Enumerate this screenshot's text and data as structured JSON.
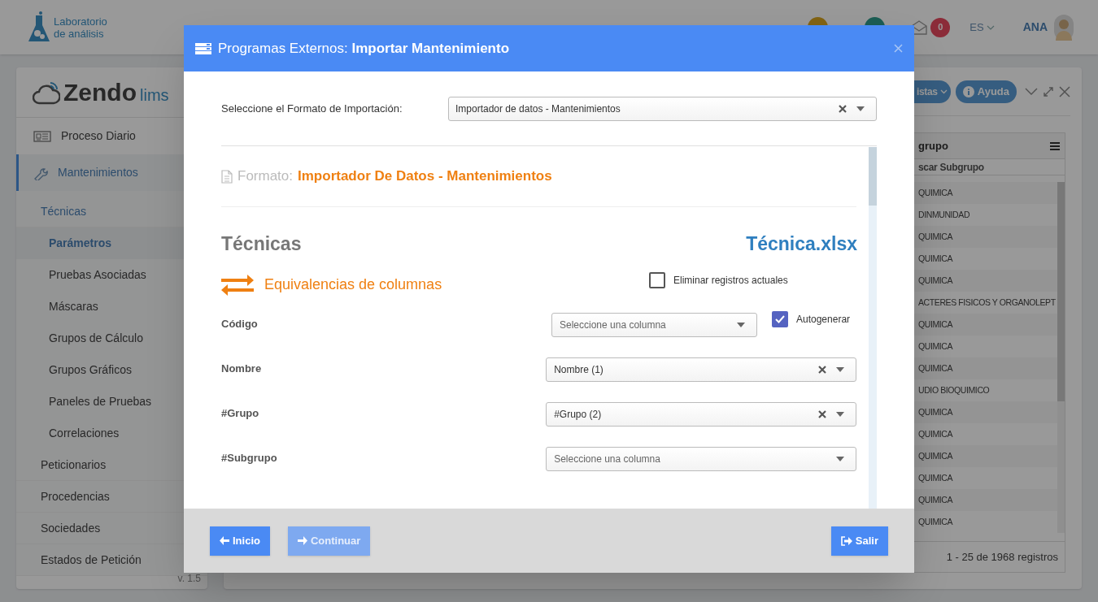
{
  "topbar": {
    "logo_line1": "Laboratorio",
    "logo_line2": "de análisis",
    "mail_count": "0",
    "language": "ES",
    "user": "ANA"
  },
  "sidebar": {
    "brand": "Zendo",
    "brand_suffix": "lims",
    "version": "v. 1.5",
    "items": [
      {
        "label": "Proceso Diario",
        "selected": false
      },
      {
        "label": "Mantenimientos",
        "selected": true,
        "expanded": true,
        "children": [
          {
            "label": "Técnicas",
            "selected": false,
            "expanded": true,
            "children": [
              {
                "label": "Parámetros",
                "selected": true
              },
              {
                "label": "Pruebas Asociadas",
                "selected": false
              },
              {
                "label": "Máscaras",
                "selected": false
              },
              {
                "label": "Grupos de Cálculo",
                "selected": false
              },
              {
                "label": "Grupos Gráficos",
                "selected": false
              },
              {
                "label": "Paneles de Pruebas",
                "selected": false
              },
              {
                "label": "Correlaciones",
                "selected": false
              }
            ]
          },
          {
            "label": "Peticionarios",
            "selected": false
          },
          {
            "label": "Procedencias",
            "selected": false
          },
          {
            "label": "Sociedades",
            "selected": false
          },
          {
            "label": "Estados de Petición",
            "selected": false
          }
        ]
      }
    ]
  },
  "panel": {
    "buttons": [
      "istas",
      "Ayuda"
    ],
    "column_header": "grupo",
    "filter": "scar Subgrupo",
    "rows": [
      "QUIMICA",
      "DINMUNIDAD",
      "QUIMICA",
      "QUIMICA",
      "QUIMICA",
      "ACTERES FISICOS Y ORGANOLEPT",
      "QUIMICA",
      "QUIMICA",
      "QUIMICA",
      "UDIO BIOQUIMICO",
      "QUIMICA",
      "QUIMICA",
      "QUIMICA",
      "QUIMICA",
      "QUIMICA",
      "QUIMICA"
    ],
    "footer": "1 - 25 de 1968 registros"
  },
  "modal": {
    "title": "Programas Externos: **Importar Mantenimiento**",
    "format_label": "Seleccione el Formato de Importación:",
    "format_value": "Importador de datos - Mantenimientos",
    "format_heading_label": "Formato:",
    "format_heading_value": "Importador De Datos - Mantenimientos",
    "section_title": "Técnicas",
    "file_name": "Técnica.xlsx",
    "equivalences_title": "Equivalencias de columnas",
    "delete_existing": {
      "label": "Eliminar registros actuales",
      "checked": false
    },
    "fields": [
      {
        "label": "Código",
        "placeholder": "Seleccione una columna",
        "autogenerate": {
          "label": "Autogenerar",
          "checked": true
        }
      },
      {
        "label": "Nombre",
        "value": "Nombre (1)"
      },
      {
        "label": "#Grupo",
        "value": "#Grupo (2)"
      },
      {
        "label": "#Subgrupo",
        "placeholder": "Seleccione una columna"
      }
    ],
    "buttons": [
      {
        "label": "Inicio",
        "disabled": false
      },
      {
        "label": "Continuar",
        "disabled": true
      },
      {
        "label": "Salir",
        "disabled": false
      }
    ]
  }
}
